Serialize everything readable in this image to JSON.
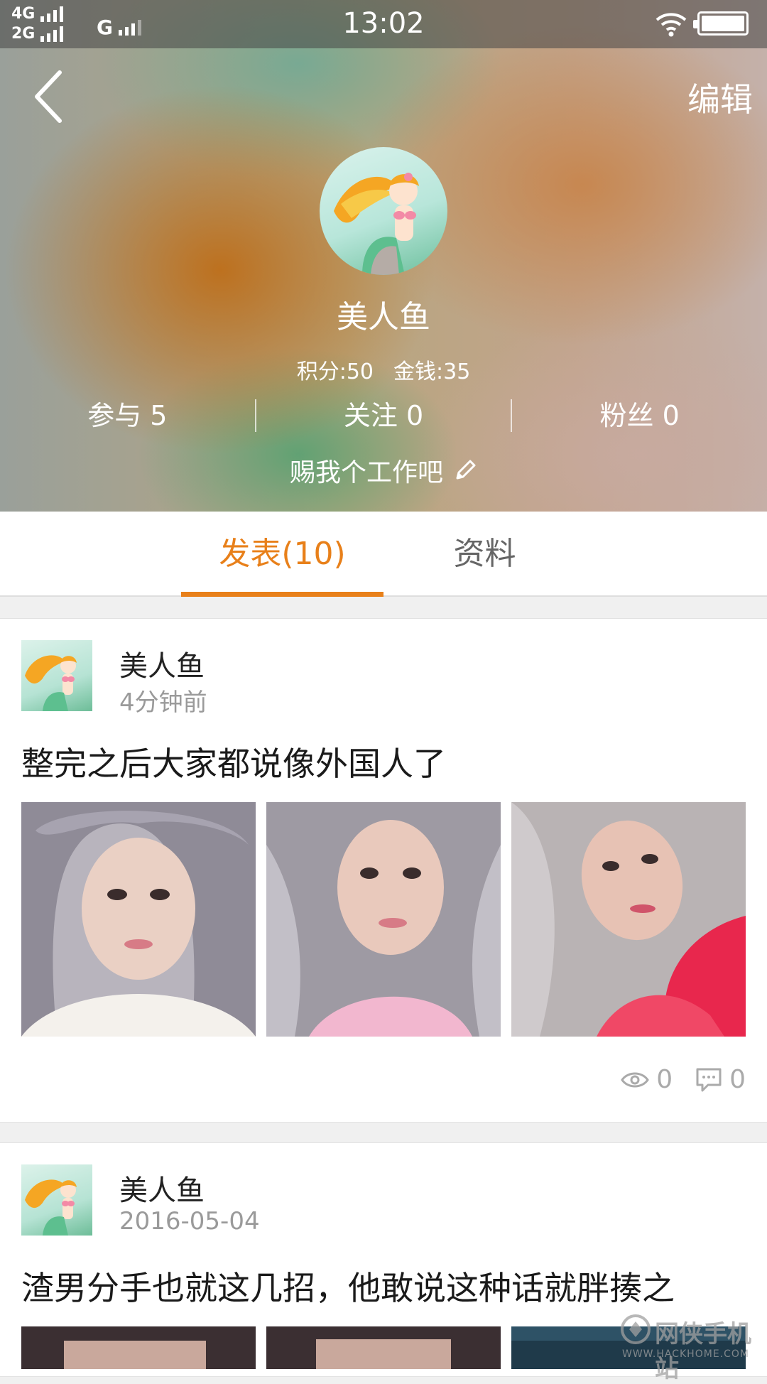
{
  "status_bar": {
    "network_1": "4G",
    "network_2": "2G",
    "network_3": "G",
    "time": "13:02"
  },
  "header": {
    "edit_label": "编辑",
    "profile_name": "美人鱼",
    "points": "积分:50",
    "money": "金钱:35",
    "stats": [
      {
        "label": "参与 5"
      },
      {
        "label": "关注 0"
      },
      {
        "label": "粉丝 0"
      }
    ],
    "signature": "赐我个工作吧"
  },
  "tabs": [
    {
      "label": "发表(10)",
      "active": true
    },
    {
      "label": "资料",
      "active": false
    }
  ],
  "posts": [
    {
      "author": "美人鱼",
      "time": "4分钟前",
      "text": "整完之后大家都说像外国人了",
      "photo_count": 3,
      "views": "0",
      "comments": "0"
    },
    {
      "author": "美人鱼",
      "time": "2016-05-04",
      "text": "渣男分手也就这几招，他敢说这种话就胖揍之",
      "photo_count": 3
    }
  ],
  "watermark": {
    "main": "网侠手机站",
    "sub": "WWW.HACKHOME.COM"
  },
  "colors": {
    "accent": "#e8801a",
    "muted_text": "#9a9a9a"
  }
}
